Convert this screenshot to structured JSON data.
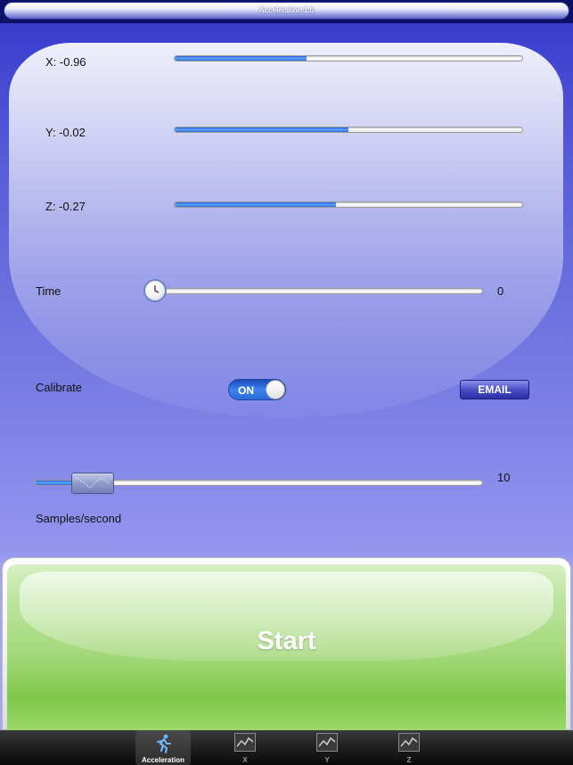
{
  "app": {
    "title": "Acceleration 1.0"
  },
  "axes": [
    {
      "label": "X: -0.96",
      "level": 0.38
    },
    {
      "label": "Y: -0.02",
      "level": 0.5
    },
    {
      "label": "Z: -0.27",
      "level": 0.465
    }
  ],
  "time": {
    "label": "Time",
    "value": "0",
    "level": 0.0
  },
  "calibrate": {
    "label": "Calibrate",
    "toggle_text": "ON",
    "email_label": "EMAIL"
  },
  "samples": {
    "label": "Samples/second",
    "value": "10",
    "level": 0.09
  },
  "start": {
    "label": "Start"
  },
  "tabs": [
    {
      "label": "Acceleration",
      "icon": "running-person-icon",
      "selected": true
    },
    {
      "label": "X",
      "icon": "line-graph-icon",
      "selected": false
    },
    {
      "label": "Y",
      "icon": "line-graph-icon",
      "selected": false
    },
    {
      "label": "Z",
      "icon": "line-graph-icon",
      "selected": false
    }
  ],
  "colors": {
    "accent_blue": "#3c82f0",
    "background_top": "#2a2fb8",
    "start_green": "#a3d879"
  }
}
